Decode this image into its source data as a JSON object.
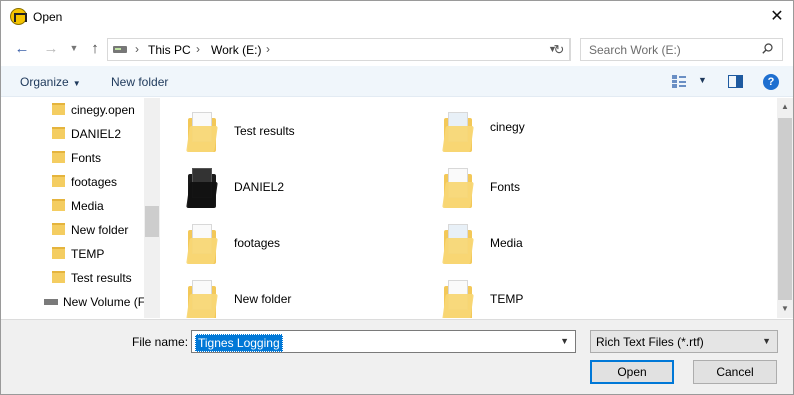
{
  "window": {
    "title": "Open"
  },
  "address": {
    "crumbs": [
      "This PC",
      "Work (E:)"
    ],
    "search_placeholder": "Search Work (E:)"
  },
  "toolbar": {
    "organize": "Organize",
    "new_folder": "New folder"
  },
  "nav_tree": {
    "folders": [
      "cinegy.open",
      "DANIEL2",
      "Fonts",
      "footages",
      "Media",
      "New folder",
      "TEMP",
      "Test results"
    ],
    "volume": "New Volume (F:"
  },
  "files": [
    {
      "name": "Test results",
      "icon": "folder-documents-icon"
    },
    {
      "name": "cinegy",
      "icon": "folder-image-icon"
    },
    {
      "name": "DANIEL2",
      "icon": "folder-dark-icon"
    },
    {
      "name": "Fonts",
      "icon": "folder-fonts-icon"
    },
    {
      "name": "footages",
      "icon": "folder-documents-icon"
    },
    {
      "name": "Media",
      "icon": "folder-image-icon"
    },
    {
      "name": "New folder",
      "icon": "folder-documents-icon"
    },
    {
      "name": "TEMP",
      "icon": "folder-edge-icon"
    }
  ],
  "bottom": {
    "file_name_label": "File name:",
    "file_name_value": "Tignes Logging",
    "file_type": "Rich Text Files (*.rtf)",
    "open_label": "Open",
    "cancel_label": "Cancel"
  },
  "colors": {
    "accent": "#0078d7",
    "folder": "#f3c858",
    "command_bar": "#f0f6fb"
  }
}
